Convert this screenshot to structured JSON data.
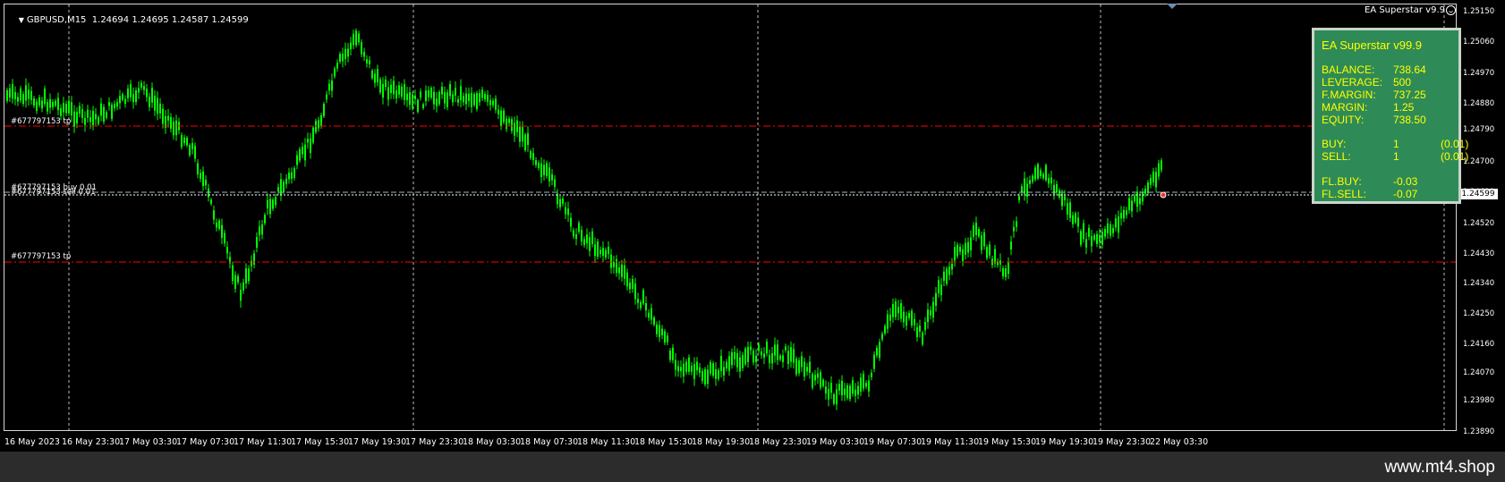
{
  "header": {
    "symbol": "GBPUSD,M15",
    "ohlc": "1.24694 1.24695 1.24587 1.24599",
    "ea_label": "EA Superstar v9.9"
  },
  "orders": [
    {
      "label": "#677797153 tp",
      "kind": "tp"
    },
    {
      "label": "#677797153 buy 0.01",
      "kind": "open"
    },
    {
      "label": "#677797153 sell 0.01",
      "kind": "open"
    },
    {
      "label": "#677797153 tp",
      "kind": "tp"
    }
  ],
  "price_axis": [
    "1.25150",
    "1.25060",
    "1.24970",
    "1.24880",
    "1.24790",
    "1.24700",
    "1.24610",
    "1.24520",
    "1.24430",
    "1.24340",
    "1.24250",
    "1.24160",
    "1.24070",
    "1.23980",
    "1.23890"
  ],
  "current_bid": "1.24599",
  "time_axis": [
    "16 May 2023",
    "16 May 23:30",
    "17 May 03:30",
    "17 May 07:30",
    "17 May 11:30",
    "17 May 15:30",
    "17 May 19:30",
    "17 May 23:30",
    "18 May 03:30",
    "18 May 07:30",
    "18 May 11:30",
    "18 May 15:30",
    "18 May 19:30",
    "18 May 23:30",
    "19 May 03:30",
    "19 May 07:30",
    "19 May 11:30",
    "19 May 15:30",
    "19 May 19:30",
    "19 May 23:30",
    "22 May 03:30"
  ],
  "ea_panel": {
    "title": "EA Superstar v99.9",
    "rows": [
      {
        "k": "BALANCE:",
        "v": "738.64",
        "v2": ""
      },
      {
        "k": "LEVERAGE:",
        "v": "500",
        "v2": ""
      },
      {
        "k": "F.MARGIN:",
        "v": "737.25",
        "v2": ""
      },
      {
        "k": "MARGIN:",
        "v": "1.25",
        "v2": ""
      },
      {
        "k": "EQUITY:",
        "v": "738.50",
        "v2": ""
      },
      {
        "k": "BUY:",
        "v": "1",
        "v2": "(0.01)"
      },
      {
        "k": "SELL:",
        "v": "1",
        "v2": "(0.01)"
      },
      {
        "k": "FL.BUY:",
        "v": "-0.03",
        "v2": ""
      },
      {
        "k": "FL.SELL:",
        "v": "-0.07",
        "v2": ""
      }
    ]
  },
  "watermark": "www.mt4.shop",
  "colors": {
    "candles": "#00ff00",
    "tp_line": "#ff0000",
    "background": "#000000",
    "panel": "#2e8b57",
    "panel_text": "#ffff00"
  }
}
